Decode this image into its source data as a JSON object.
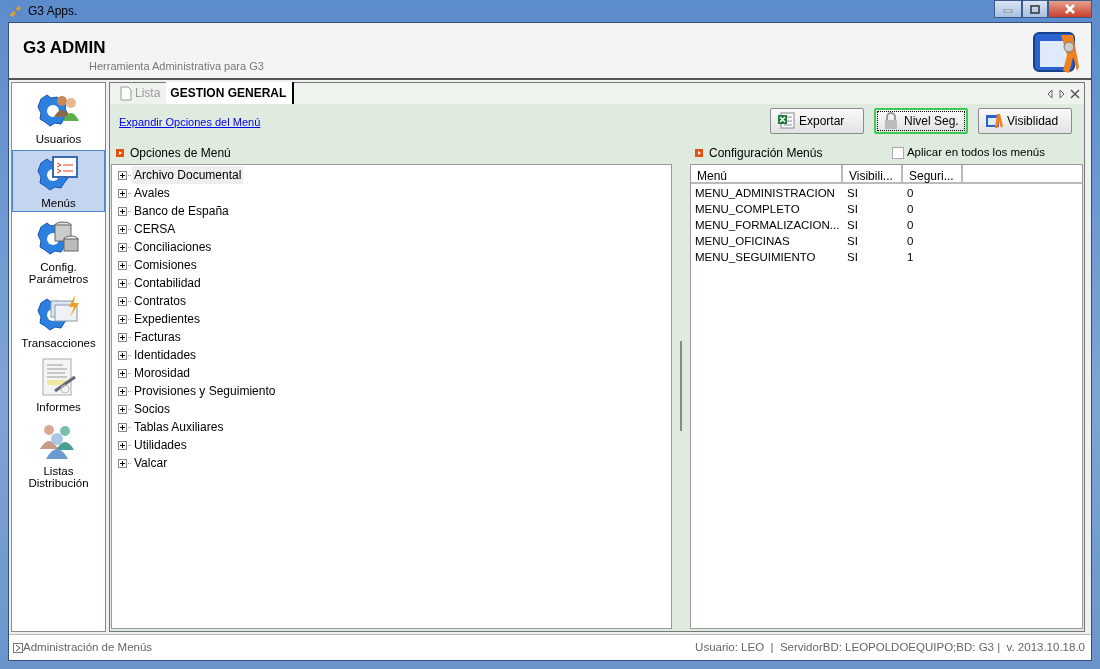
{
  "window": {
    "title": "G3 Apps."
  },
  "header": {
    "title": "G3 ADMIN",
    "subtitle": "Herramienta Administrativa para G3"
  },
  "sidebar": {
    "items": [
      {
        "label": "Usuarios",
        "selected": false
      },
      {
        "label": "Menús",
        "selected": true
      },
      {
        "label": "Config. Parámetros",
        "selected": false
      },
      {
        "label": "Transacciones",
        "selected": false
      },
      {
        "label": "Informes",
        "selected": false
      },
      {
        "label": "Listas Distribución",
        "selected": false
      }
    ]
  },
  "tabs": [
    {
      "label": "Lista",
      "selected": false
    },
    {
      "label": "GESTION GENERAL",
      "selected": true
    }
  ],
  "expand_link": "Expandir Opciones del Menú",
  "buttons": [
    {
      "label": "Exportar",
      "focused": false
    },
    {
      "label": "Nivel Seg.",
      "focused": true
    },
    {
      "label": "Visiblidad",
      "focused": false
    }
  ],
  "left_panel": {
    "title": "Opciones de Menú",
    "tree": [
      {
        "label": "Archivo Documental",
        "expanded": false,
        "selected": true
      },
      {
        "label": "Avales",
        "expanded": false,
        "selected": false
      },
      {
        "label": "Banco de España",
        "expanded": false,
        "selected": false
      },
      {
        "label": "CERSA",
        "expanded": false,
        "selected": false
      },
      {
        "label": "Conciliaciones",
        "expanded": false,
        "selected": false
      },
      {
        "label": "Comisiones",
        "expanded": false,
        "selected": false
      },
      {
        "label": "Contabilidad",
        "expanded": false,
        "selected": false
      },
      {
        "label": "Contratos",
        "expanded": false,
        "selected": false
      },
      {
        "label": "Expedientes",
        "expanded": false,
        "selected": false
      },
      {
        "label": "Facturas",
        "expanded": false,
        "selected": false
      },
      {
        "label": "Identidades",
        "expanded": false,
        "selected": false
      },
      {
        "label": "Morosidad",
        "expanded": false,
        "selected": false
      },
      {
        "label": "Provisiones y Seguimiento",
        "expanded": false,
        "selected": false
      },
      {
        "label": "Socios",
        "expanded": false,
        "selected": false
      },
      {
        "label": "Tablas Auxiliares",
        "expanded": false,
        "selected": false
      },
      {
        "label": "Utilidades",
        "expanded": false,
        "selected": false
      },
      {
        "label": "Valcar",
        "expanded": false,
        "selected": false
      }
    ]
  },
  "right_panel": {
    "title": "Configuración Menús",
    "apply_all": {
      "label": "Aplicar en todos los menús",
      "checked": false
    },
    "table": {
      "columns": [
        "Menú",
        "Visibili...",
        "Seguri..."
      ],
      "rows": [
        [
          "MENU_ADMINISTRACION",
          "SI",
          "0"
        ],
        [
          "MENU_COMPLETO",
          "SI",
          "0"
        ],
        [
          "MENU_FORMALIZACION...",
          "SI",
          "0"
        ],
        [
          "MENU_OFICINAS",
          "SI",
          "0"
        ],
        [
          "MENU_SEGUIMIENTO",
          "SI",
          "1"
        ]
      ]
    }
  },
  "status_bar": {
    "left": "Administración de Menús",
    "right": "Usuario: LEO  |  ServidorBD: LEOPOLDOEQUIPO;BD: G3 |  v. 2013.10.18.0"
  }
}
